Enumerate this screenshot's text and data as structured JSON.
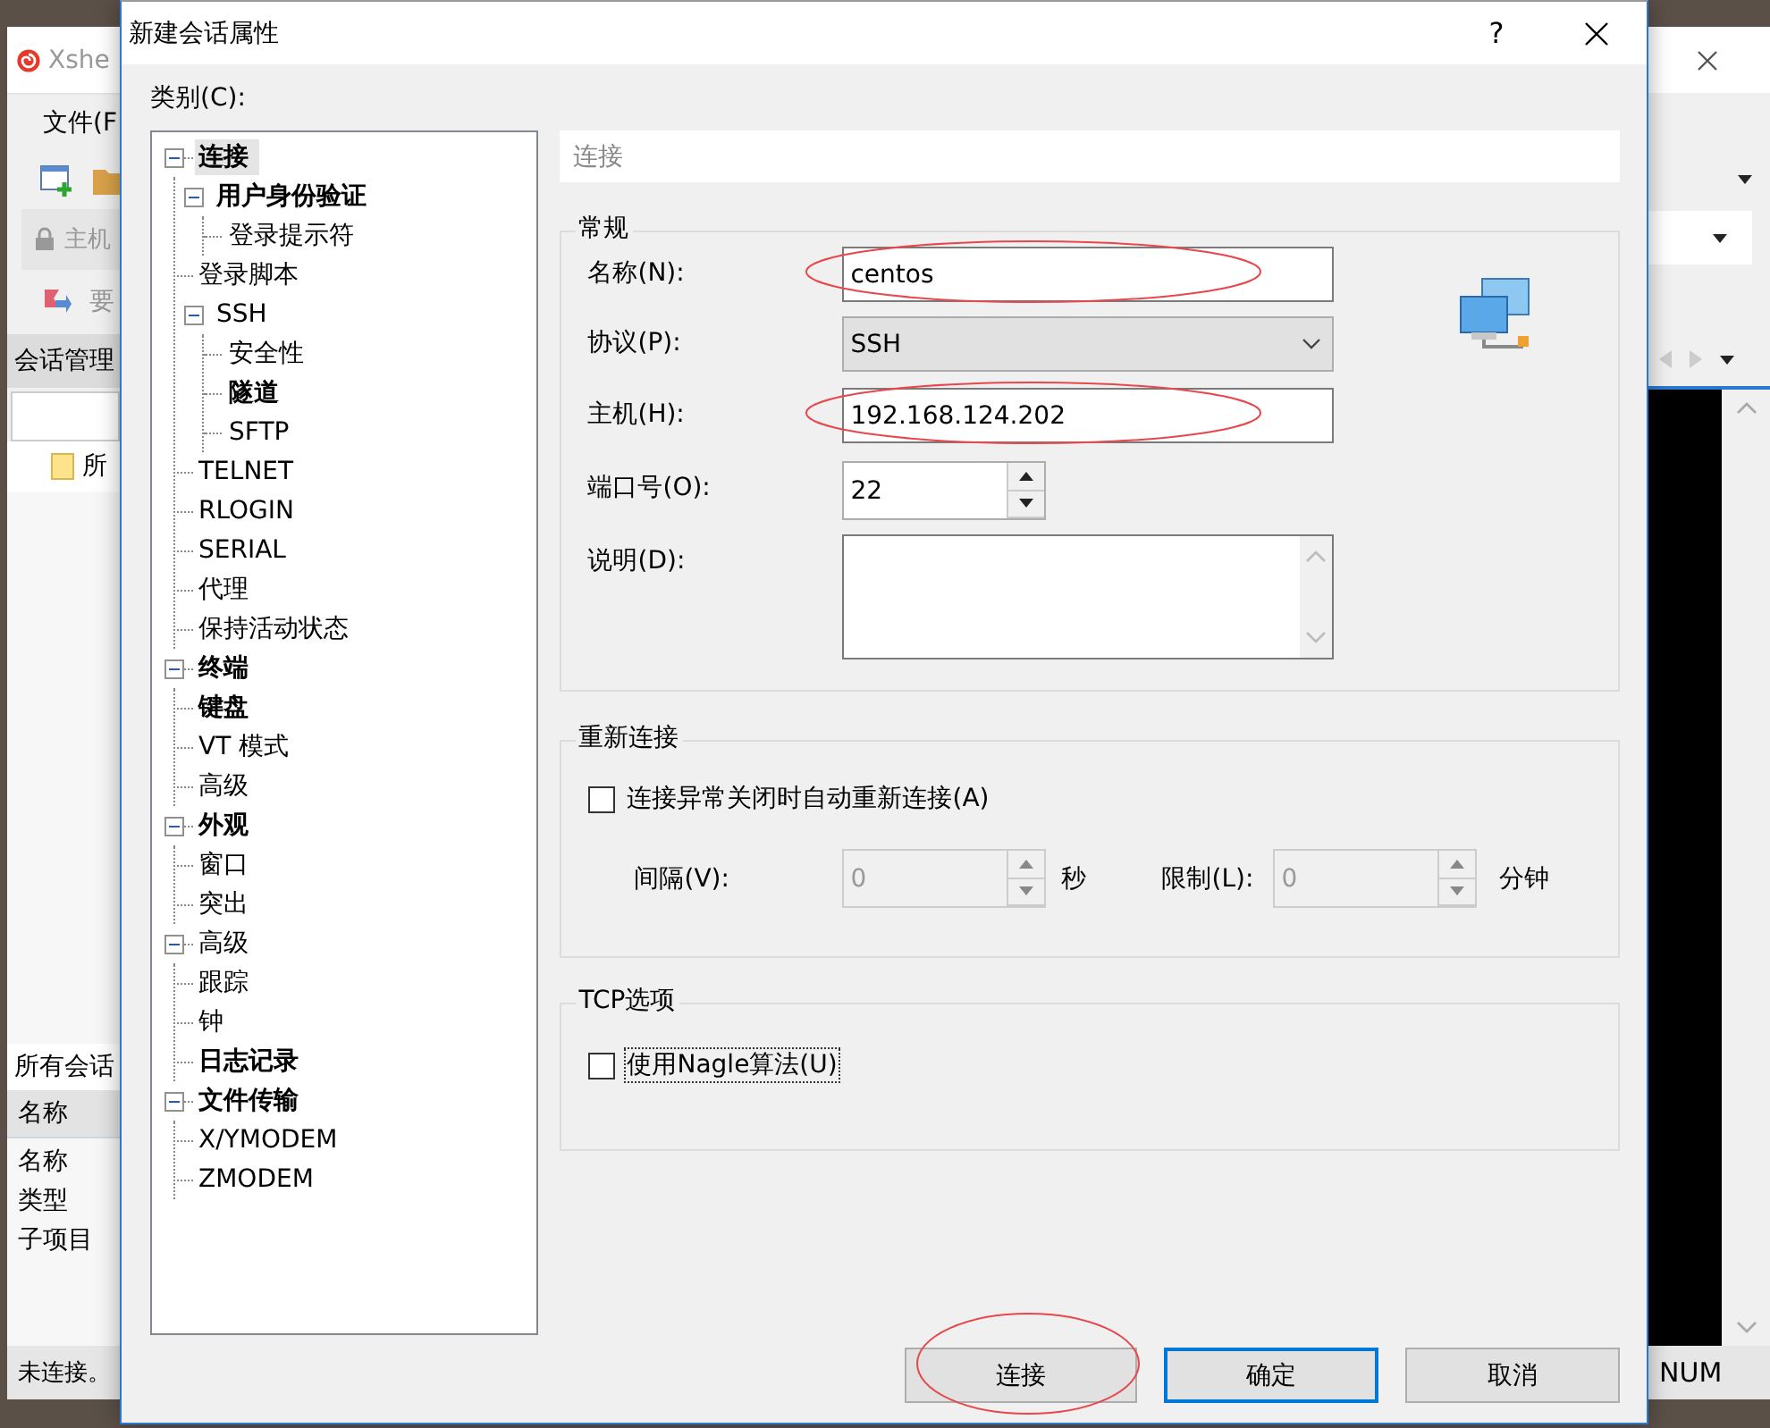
{
  "background_window": {
    "title": "Xshe",
    "menu": "文件(F",
    "address_placeholder": "主机",
    "link": "要",
    "session_panel_title": "会话管理",
    "session_tree_item": "所",
    "sessions_title": "所有会话",
    "column_header": "名称",
    "properties": [
      "名称",
      "类型",
      "子项目"
    ],
    "status": "未连接。",
    "status_indicator": "NUM"
  },
  "dialog": {
    "title": "新建会话属性",
    "help": "?"
  },
  "category_label": "类别(C):",
  "tree": [
    {
      "label": "连接",
      "bold": true,
      "selected": true,
      "expanded": true,
      "children": [
        {
          "label": "用户身份验证",
          "bold": true,
          "selected": false,
          "expanded": true,
          "children": [
            {
              "label": "登录提示符",
              "selected": false
            }
          ]
        },
        {
          "label": "登录脚本",
          "selected": false
        },
        {
          "label": "SSH",
          "selected": false,
          "expanded": true,
          "children": [
            {
              "label": "安全性",
              "selected": false
            },
            {
              "label": "隧道",
              "bold": true,
              "selected": false
            },
            {
              "label": "SFTP",
              "selected": false
            }
          ]
        },
        {
          "label": "TELNET",
          "selected": false
        },
        {
          "label": "RLOGIN",
          "selected": false
        },
        {
          "label": "SERIAL",
          "selected": false
        },
        {
          "label": "代理",
          "selected": false
        },
        {
          "label": "保持活动状态",
          "selected": false
        }
      ]
    },
    {
      "label": "终端",
      "bold": true,
      "selected": false,
      "expanded": true,
      "children": [
        {
          "label": "键盘",
          "bold": true,
          "selected": false
        },
        {
          "label": "VT 模式",
          "selected": false
        },
        {
          "label": "高级",
          "selected": false
        }
      ]
    },
    {
      "label": "外观",
      "bold": true,
      "selected": false,
      "expanded": true,
      "children": [
        {
          "label": "窗口",
          "selected": false
        },
        {
          "label": "突出",
          "selected": false
        }
      ]
    },
    {
      "label": "高级",
      "selected": false,
      "expanded": true,
      "children": [
        {
          "label": "跟踪",
          "selected": false
        },
        {
          "label": "钟",
          "selected": false
        },
        {
          "label": "日志记录",
          "bold": true,
          "selected": false
        }
      ]
    },
    {
      "label": "文件传输",
      "bold": true,
      "selected": false,
      "expanded": true,
      "children": [
        {
          "label": "X/YMODEM",
          "selected": false
        },
        {
          "label": "ZMODEM",
          "selected": false
        }
      ]
    }
  ],
  "page_header": "连接",
  "general": {
    "title": "常规",
    "fields": [
      {
        "kind": "text",
        "label": "名称(N):",
        "value": "centos",
        "highlighted": true
      },
      {
        "kind": "select",
        "label": "协议(P):",
        "value": "SSH",
        "highlighted": false
      },
      {
        "kind": "text",
        "label": "主机(H):",
        "value": "192.168.124.202",
        "highlighted": true
      },
      {
        "kind": "spinner",
        "label": "端口号(O):",
        "value": "22",
        "highlighted": false
      },
      {
        "kind": "textarea",
        "label": "说明(D):",
        "highlighted": false
      }
    ]
  },
  "reconnect": {
    "title": "重新连接",
    "checkbox": {
      "label": "连接异常关闭时自动重新连接(A)",
      "checked": false,
      "focused": false
    },
    "spinners": [
      {
        "label": "间隔(V):",
        "value": "0",
        "unit": "秒",
        "disabled": true
      },
      {
        "label": "限制(L):",
        "value": "0",
        "unit": "分钟",
        "disabled": true
      }
    ]
  },
  "tcp": {
    "title": "TCP选项",
    "checkbox": {
      "label": "使用Nagle算法(U)",
      "checked": false,
      "focused": true
    }
  },
  "buttons": [
    {
      "label": "连接",
      "default": false,
      "highlighted": true
    },
    {
      "label": "确定",
      "default": true,
      "highlighted": false
    },
    {
      "label": "取消",
      "default": false,
      "highlighted": false
    }
  ]
}
